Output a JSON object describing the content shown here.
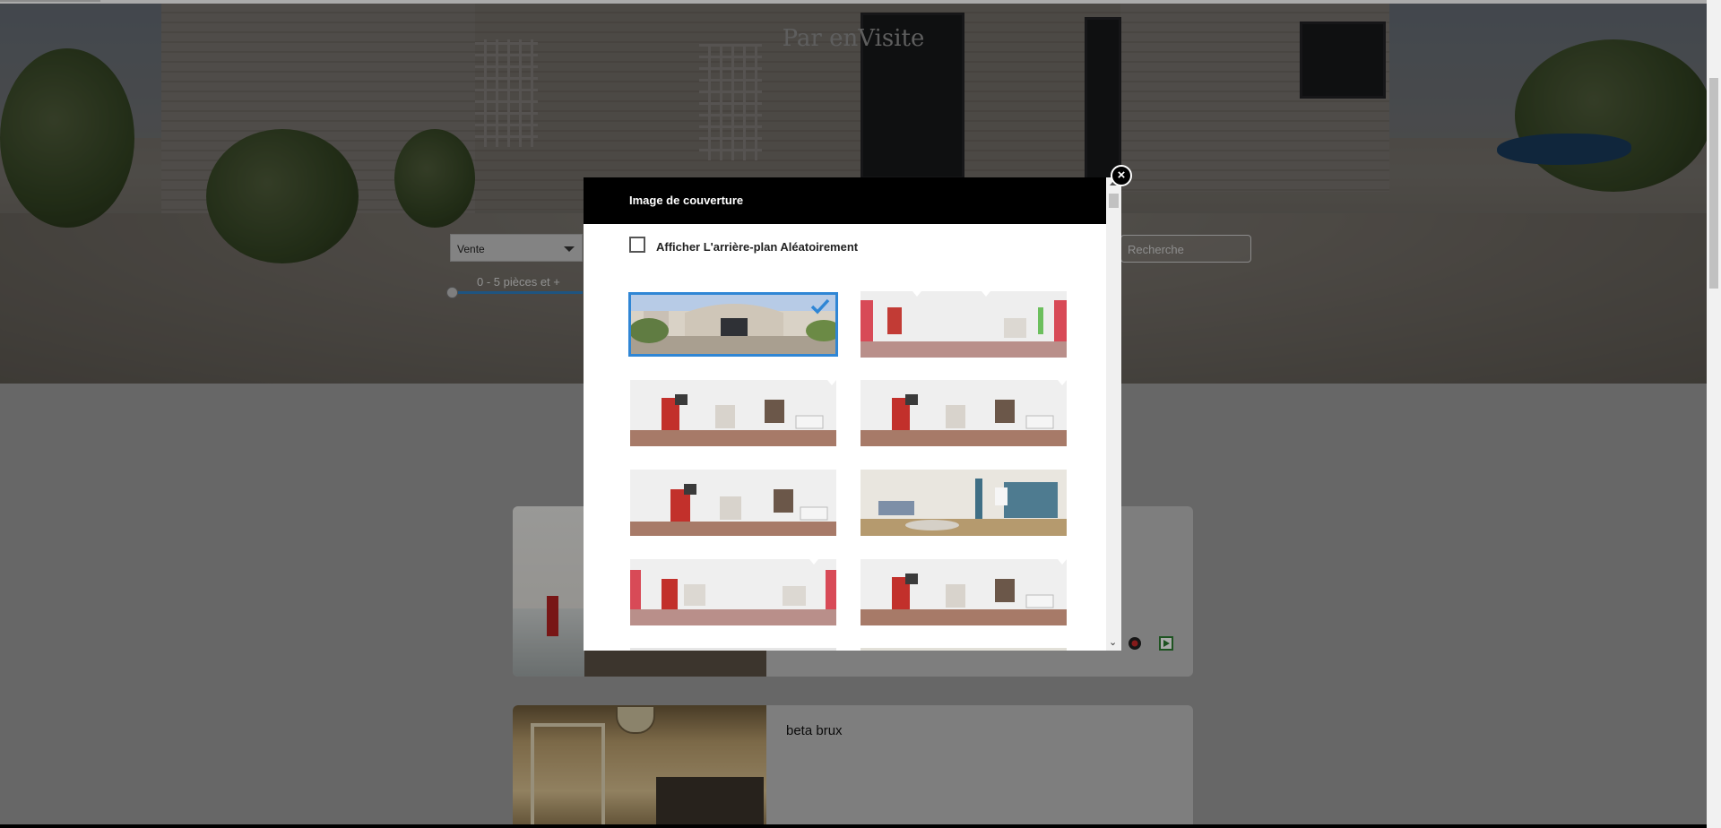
{
  "hero": {
    "title": "Par enVisite",
    "transaction_select": "Vente",
    "rooms_range_label": "0 - 5 pièces et +",
    "rooms_range_min": 0,
    "search_button": "Recherche"
  },
  "listings": [
    {
      "title": ""
    },
    {
      "title": "beta brux"
    }
  ],
  "modal": {
    "title": "Image de couverture",
    "random_background_label": "Afficher L'arrière-plan Aléatoirement",
    "random_background_checked": false,
    "close_label": "×",
    "selected_index": 0,
    "images": [
      {
        "name": "exterior-terrace-panorama",
        "selected": true
      },
      {
        "name": "children-room-pink-panorama",
        "selected": false
      },
      {
        "name": "children-room-panorama",
        "selected": false
      },
      {
        "name": "children-room-panorama",
        "selected": false
      },
      {
        "name": "children-room-panorama",
        "selected": false
      },
      {
        "name": "living-room-panorama",
        "selected": false
      },
      {
        "name": "children-room-pink-panorama",
        "selected": false
      },
      {
        "name": "children-room-panorama",
        "selected": false
      },
      {
        "name": "partial-panorama",
        "selected": false
      },
      {
        "name": "partial-panorama",
        "selected": false
      }
    ]
  },
  "colors": {
    "accent": "#2f86d5",
    "modal_header": "#000000",
    "range_track": "#2f7ebf"
  },
  "icons": [
    "close-icon",
    "checkmark-icon",
    "dropdown-caret-icon",
    "record-icon",
    "play-icon"
  ]
}
